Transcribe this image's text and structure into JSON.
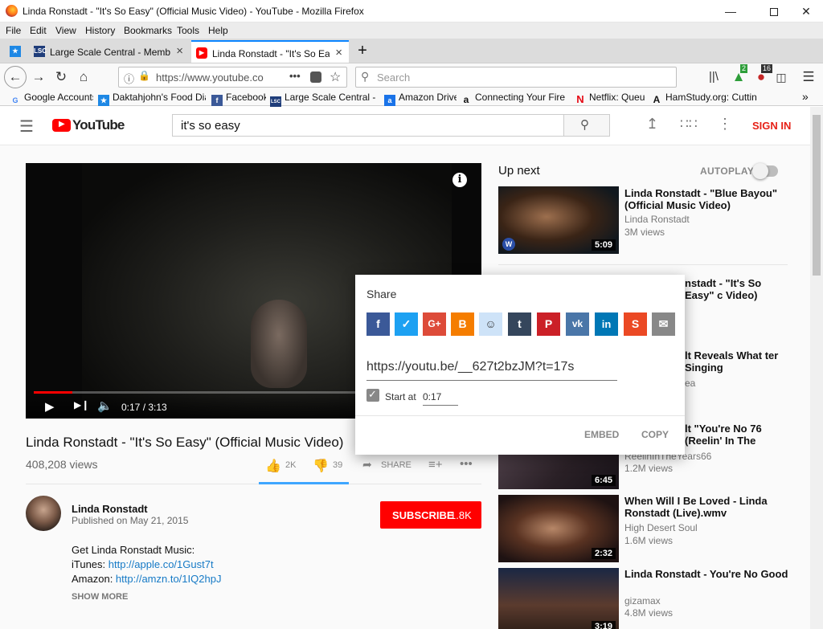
{
  "window": {
    "title": "Linda Ronstadt - \"It's So Easy\" (Official Music Video) - YouTube - Mozilla Firefox"
  },
  "menu": [
    "File",
    "Edit",
    "View",
    "History",
    "Bookmarks",
    "Tools",
    "Help"
  ],
  "tabs": [
    {
      "label": "Large Scale Central - Member H",
      "fav": "LSC"
    },
    {
      "label": "Linda Ronstadt - \"It's So Easy\" (",
      "fav": "yt"
    }
  ],
  "nav": {
    "url": "https://www.youtube.co",
    "search_placeholder": "Search",
    "badge_green": "2",
    "badge_red": "16"
  },
  "bookmarks": [
    "Google Accounts",
    "Daktahjohn's Food Dia...",
    "Facebook",
    "Large Scale Central - L...",
    "Amazon Drive",
    "Connecting Your Fire ...",
    "Netflix: Queue",
    "HamStudy.org: Cuttin..."
  ],
  "youtube": {
    "logo_text": "YouTube",
    "search_value": "it's so easy",
    "sign_in": "SIGN IN"
  },
  "player": {
    "time": "0:17 / 3:13",
    "progress": 0.088
  },
  "video": {
    "title": "Linda Ronstadt - \"It's So Easy\" (Official Music Video)",
    "views": "408,208 views",
    "likes": "2K",
    "dislikes": "39",
    "share_label": "SHARE",
    "channel": "Linda Ronstadt",
    "published": "Published on May 21, 2015",
    "subscribe_label": "SUBSCRIBE",
    "subscriber_count": "1.8K",
    "desc_line1": "Get Linda Ronstadt Music:",
    "desc_itunes_label": "iTunes: ",
    "desc_itunes_link": "http://apple.co/1Gust7t",
    "desc_amazon_label": "Amazon: ",
    "desc_amazon_link": "http://amzn.to/1IQ2hpJ",
    "show_more": "SHOW MORE"
  },
  "sidebar": {
    "upnext": "Up next",
    "autoplay": "AUTOPLAY",
    "items": [
      {
        "title": "Linda Ronstadt - \"Blue Bayou\" (Official Music Video)",
        "channel": "Linda Ronstadt",
        "views": "3M views",
        "duration": "5:09"
      },
      {
        "title": "nstadt - \"It's So Easy\" c Video)",
        "channel": "",
        "views": "",
        "duration": ""
      },
      {
        "title": "lt Reveals What ter Singing",
        "channel": "ea",
        "views": "",
        "duration": ""
      },
      {
        "title": "lt \"You're No 76 (Reelin' In The",
        "channel": "ReelinInTheYears66",
        "views": "1.2M views",
        "duration": "6:45"
      },
      {
        "title": "When Will I Be Loved - Linda Ronstadt (Live).wmv",
        "channel": "High Desert Soul",
        "views": "1.6M views",
        "duration": "2:32"
      },
      {
        "title": "Linda Ronstadt - You're No Good",
        "channel": "gizamax",
        "views": "4.8M views",
        "duration": "3:19"
      }
    ]
  },
  "share": {
    "title": "Share",
    "url": "https://youtu.be/__627t2bzJM?t=17s",
    "start_label": "Start at",
    "start_value": "0:17",
    "embed": "EMBED",
    "copy": "COPY"
  }
}
